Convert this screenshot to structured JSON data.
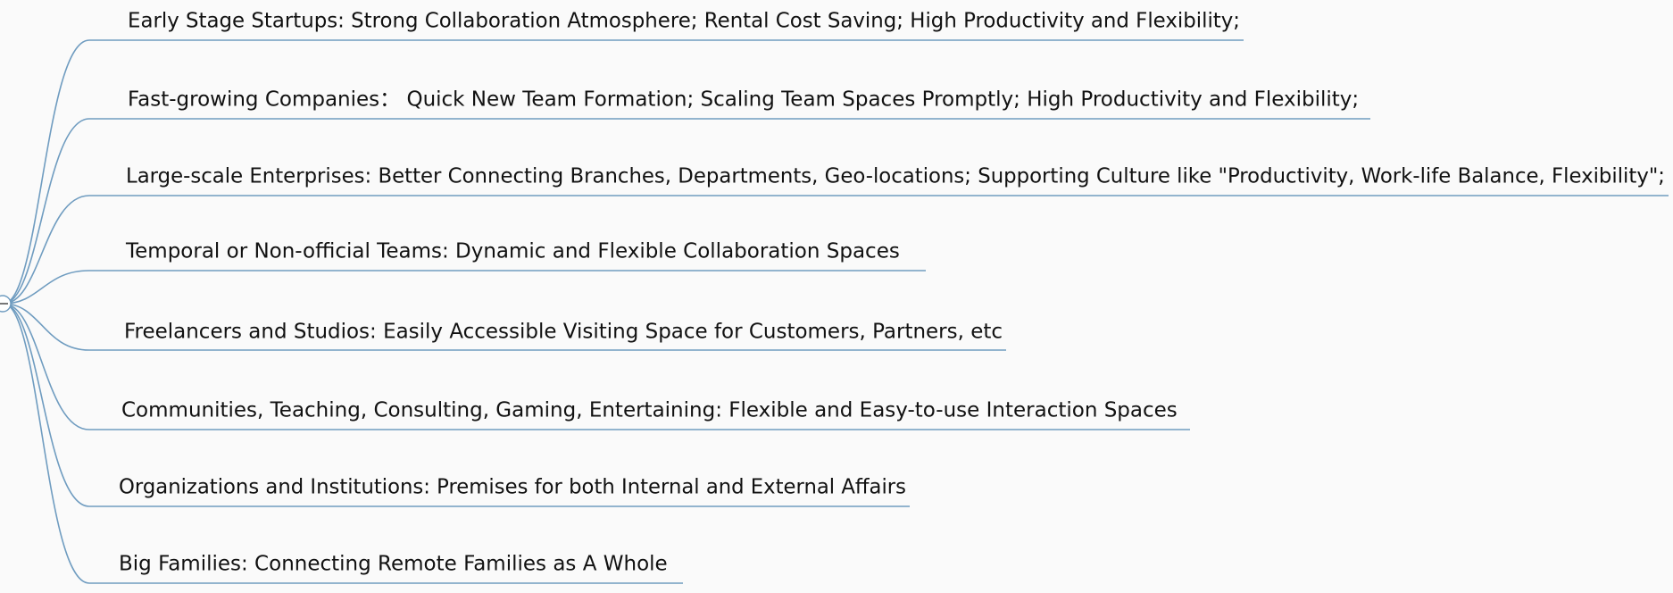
{
  "colors": {
    "branch_line": "#6f9cc0",
    "text": "#111111",
    "background": "#fafafa"
  },
  "root": {
    "collapse_icon": "minus-icon"
  },
  "branches": [
    "Early Stage Startups: Strong Collaboration Atmosphere; Rental Cost Saving; High Productivity and Flexibility;",
    "Fast-growing Companies： Quick New Team Formation; Scaling Team Spaces Promptly; High Productivity and Flexibility;",
    "Large-scale Enterprises: Better Connecting Branches, Departments, Geo-locations; Supporting Culture like \"Productivity, Work-life Balance, Flexibility\";",
    "Temporal or Non-official Teams: Dynamic and Flexible Collaboration Spaces",
    "Freelancers and Studios: Easily Accessible Visiting Space for Customers, Partners, etc",
    "Communities, Teaching, Consulting, Gaming, Entertaining: Flexible and Easy-to-use Interaction Spaces",
    "Organizations and Institutions: Premises for both Internal and External Affairs",
    "Big Families: Connecting Remote Families as A Whole"
  ]
}
